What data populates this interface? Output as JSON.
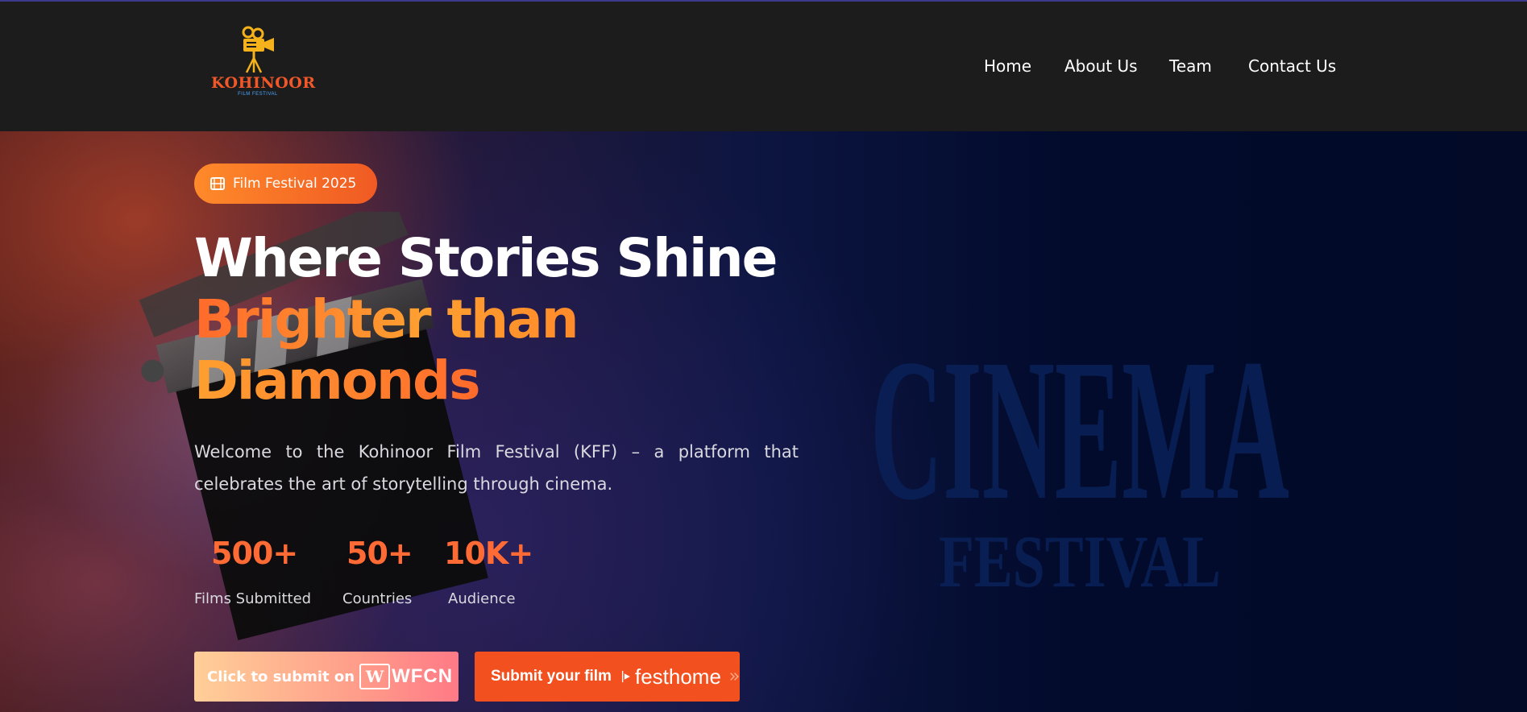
{
  "brand": {
    "logo_word": "KOHINOOR",
    "logo_sub": "FILM FESTIVAL",
    "logo_icon": "film-camera-icon"
  },
  "nav": {
    "items": [
      {
        "label": "Home"
      },
      {
        "label": "About Us"
      },
      {
        "label": "Team"
      },
      {
        "label": "Contact Us"
      }
    ]
  },
  "hero": {
    "badge": {
      "icon": "film-icon",
      "label": "Film Festival 2025"
    },
    "title_line1": "Where Stories Shine",
    "title_line2": "Brighter than",
    "title_line3": "Diamonds",
    "description": "Welcome to the Kohinoor Film Festival (KFF) – a platform that celebrates the art of storytelling through cinema.",
    "stats": [
      {
        "value": "500+",
        "label": "Films Submitted"
      },
      {
        "value": "50+",
        "label": "Countries"
      },
      {
        "value": "10K+",
        "label": "Audience"
      }
    ],
    "background_art": {
      "word": "CINEMA",
      "sub": "FESTIVAL"
    },
    "buttons": {
      "wfcn": {
        "lead": "Click to submit on",
        "mark": "W",
        "brand": "WFCN"
      },
      "festhome": {
        "lead": "Submit your film",
        "brand": "festhome"
      }
    }
  },
  "colors": {
    "accent": "#f2501f",
    "accent_gradient_start": "#ff8a2a",
    "header_bg": "#1c1c1c",
    "hero_bg": "#020a28"
  }
}
